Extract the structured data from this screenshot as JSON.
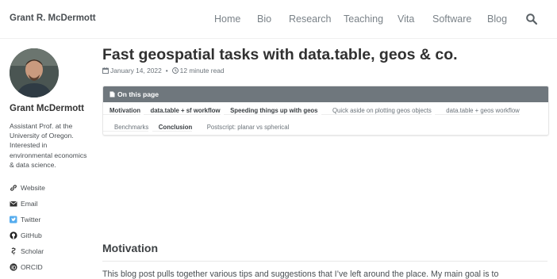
{
  "masthead": {
    "site_title": "Grant R. McDermott",
    "nav": [
      "Home",
      "Bio",
      "Research",
      "Teaching",
      "Vita",
      "Software",
      "Blog"
    ],
    "search_icon": "search-icon"
  },
  "sidebar": {
    "author_name": "Grant McDermott",
    "author_bio": "Assistant Prof. at the University of Oregon. Interested in environmental economics & data science.",
    "links": [
      {
        "label": "Website",
        "icon": "link-icon"
      },
      {
        "label": "Email",
        "icon": "envelope-icon"
      },
      {
        "label": "Twitter",
        "icon": "twitter-icon"
      },
      {
        "label": "GitHub",
        "icon": "github-icon"
      },
      {
        "label": "Scholar",
        "icon": "scholar-icon"
      },
      {
        "label": "ORCID",
        "icon": "orcid-icon"
      }
    ]
  },
  "post": {
    "title": "Fast geospatial tasks with data.table, geos & co.",
    "date": "January 14, 2022",
    "separator": "•",
    "read_time": "12 minute read",
    "toc_title": "On this page",
    "toc": [
      {
        "label": "Motivation",
        "level": 1
      },
      {
        "label": "data.table + sf workflow",
        "level": 1
      },
      {
        "label": "Speeding things up with geos",
        "level": 1
      },
      {
        "label": "Quick aside on plotting geos objects",
        "level": 2
      },
      {
        "label": "data.table + geos workflow",
        "level": 2
      },
      {
        "label": "Benchmarks",
        "level": 2
      },
      {
        "label": "Conclusion",
        "level": 1
      },
      {
        "label": "Postscript: planar vs spherical",
        "level": 2
      }
    ],
    "section_heading": "Motivation",
    "intro": "This blog post pulls together various tips and suggestions that I’ve left around the place. My main goal is to"
  },
  "colors": {
    "nav_text": "#7a8288",
    "toc_header_bg": "#6f777d",
    "text": "#494e52"
  }
}
